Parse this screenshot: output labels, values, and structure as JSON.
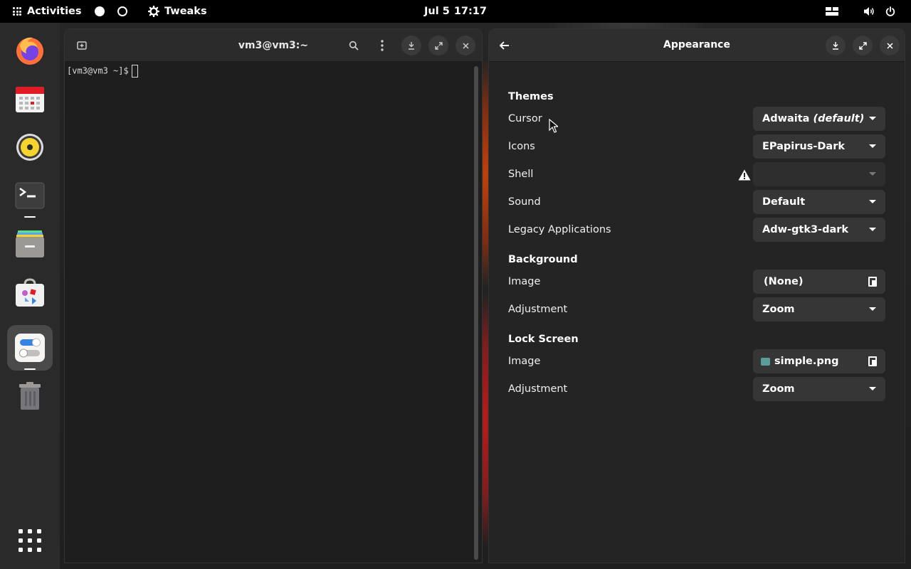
{
  "topbar": {
    "activities_label": "Activities",
    "app_name": "Tweaks",
    "date": "Jul 5",
    "time": "17:17"
  },
  "dock": {
    "items": [
      {
        "name": "firefox-icon"
      },
      {
        "name": "calendar-icon"
      },
      {
        "name": "rhythmbox-icon"
      },
      {
        "name": "terminal-icon"
      },
      {
        "name": "files-icon"
      },
      {
        "name": "software-icon"
      },
      {
        "name": "tweaks-icon"
      },
      {
        "name": "trash-icon"
      },
      {
        "name": "app-grid-icon"
      }
    ]
  },
  "terminal": {
    "title": "vm3@vm3:~",
    "prompt": "[vm3@vm3 ~]$"
  },
  "tweaks": {
    "title": "Appearance",
    "themes": {
      "section": "Themes",
      "cursor_label": "Cursor",
      "cursor_value_main": "Adwaita",
      "cursor_value_suffix": "(default)",
      "icons_label": "Icons",
      "icons_value": "EPapirus-Dark",
      "shell_label": "Shell",
      "shell_value": "",
      "sound_label": "Sound",
      "sound_value": "Default",
      "legacy_label": "Legacy Applications",
      "legacy_value": "Adw-gtk3-dark"
    },
    "background": {
      "section": "Background",
      "image_label": "Image",
      "image_value": "(None)",
      "adjustment_label": "Adjustment",
      "adjustment_value": "Zoom"
    },
    "lockscreen": {
      "section": "Lock Screen",
      "image_label": "Image",
      "image_value": "simple.png",
      "adjustment_label": "Adjustment",
      "adjustment_value": "Zoom"
    }
  },
  "colors": {
    "topbar": "#000000",
    "dock": "#2a2a2a",
    "window": "#242424",
    "combo": "#363636"
  }
}
